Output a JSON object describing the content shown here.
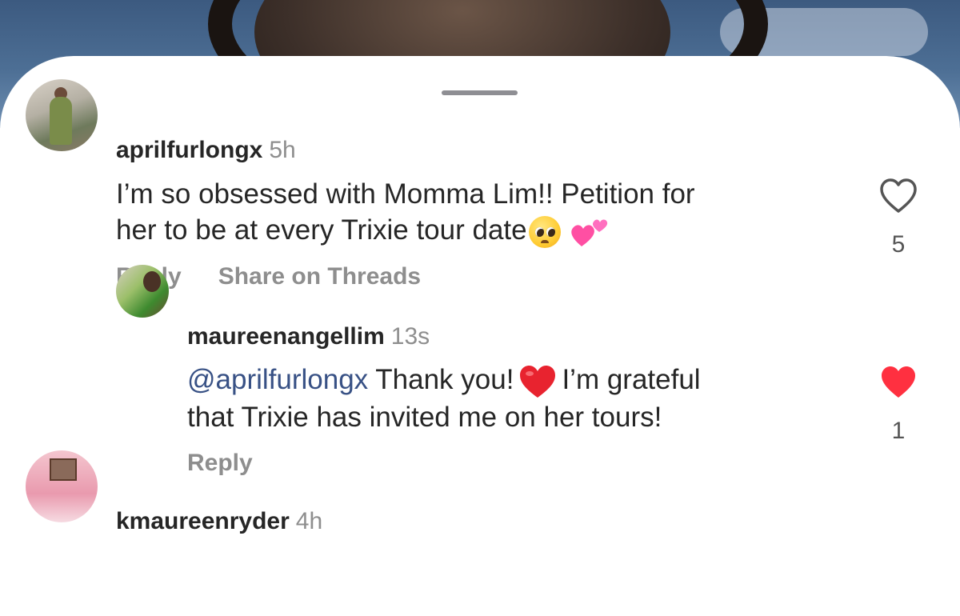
{
  "comments": [
    {
      "username": "aprilfurlongx",
      "time": "5h",
      "text_line1": "I’m so obsessed with Momma Lim!! Petition for",
      "text_line2": "her to be at every Trixie tour date",
      "reply_label": "Reply",
      "share_label": "Share on Threads",
      "likes": "5",
      "liked": false
    },
    {
      "username": "maureenangellim",
      "time": "13s",
      "mention": "@aprilfurlongx",
      "text_line1": "Thank you!",
      "text_line1_end": "I’m grateful",
      "text_line2": "that Trixie has invited me on her tours!",
      "reply_label": "Reply",
      "likes": "1",
      "liked": true
    },
    {
      "username": "kmaureenryder",
      "time": "4h"
    }
  ],
  "icons": {
    "like_empty": "heart-outline-icon",
    "like_filled": "heart-filled-icon",
    "like_filled_color": "#ff3040",
    "like_empty_color": "#555555"
  },
  "colors": {
    "mention": "#385185",
    "secondary_text": "#8e8e8e",
    "primary_text": "#262626"
  }
}
